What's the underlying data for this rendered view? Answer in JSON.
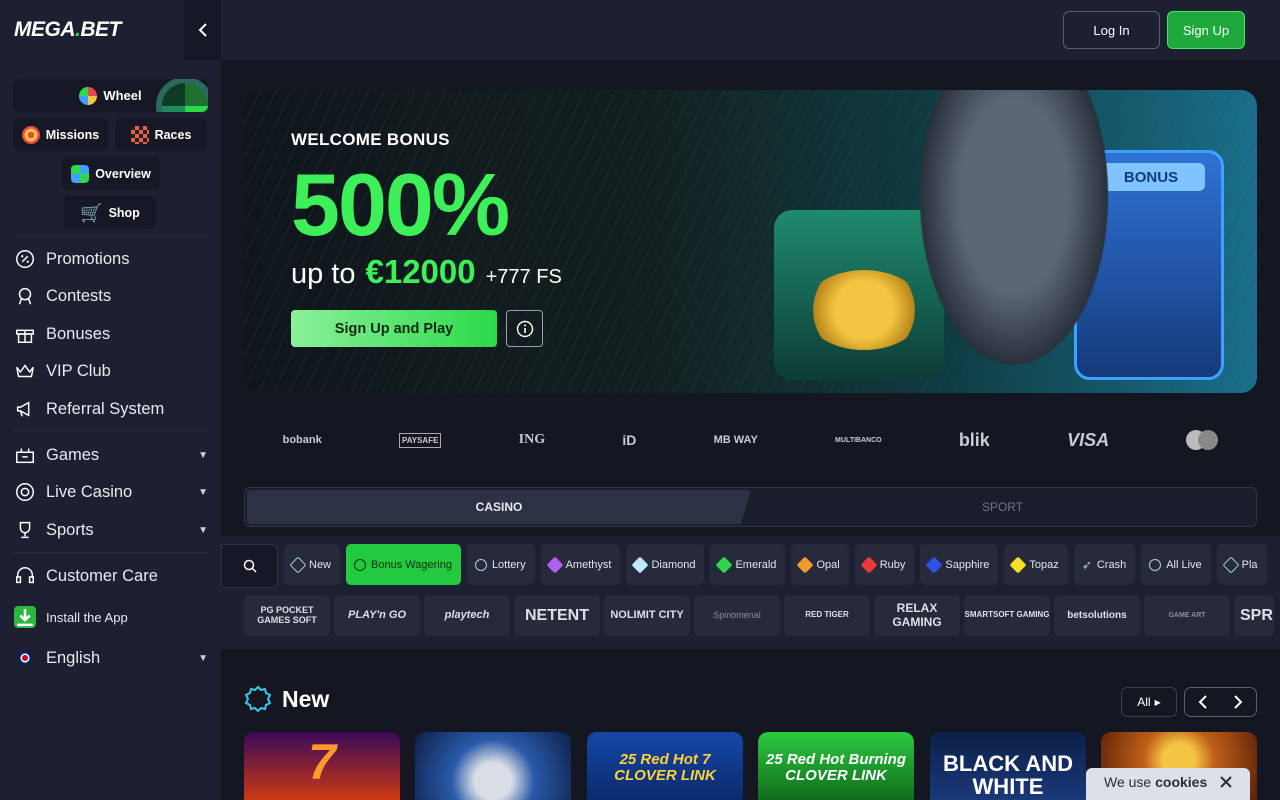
{
  "brand": {
    "logo_left": "MEGA",
    "logo_dot": ".",
    "logo_right": "BET"
  },
  "sidebar": {
    "wheel": "Wheel",
    "missions": "Missions",
    "races": "Races",
    "overview": "Overview",
    "shop": "Shop",
    "nav": [
      {
        "label": "Promotions",
        "icon": "promotion-badge-icon"
      },
      {
        "label": "Contests",
        "icon": "contest-icon"
      },
      {
        "label": "Bonuses",
        "icon": "gift-icon"
      },
      {
        "label": "VIP Club",
        "icon": "crown-icon"
      },
      {
        "label": "Referral System",
        "icon": "megaphone-icon"
      }
    ],
    "nav2": [
      {
        "label": "Games",
        "icon": "games-icon"
      },
      {
        "label": "Live Casino",
        "icon": "live-casino-icon"
      },
      {
        "label": "Sports",
        "icon": "trophy-icon"
      }
    ],
    "customer_care": "Customer Care",
    "install_app": "Install the App",
    "language": "English"
  },
  "header": {
    "login": "Log In",
    "signup": "Sign Up"
  },
  "hero": {
    "title": "WELCOME BONUS",
    "percent": "500%",
    "up_to": "up to",
    "amount": "€12000",
    "free_spins": "+777 FS",
    "cta": "Sign Up and Play",
    "slot_label": "BONUS"
  },
  "payments": [
    "bobank",
    "PAYSAFE",
    "ING",
    "iD",
    "MB WAY",
    "MULTIBANCO",
    "blik",
    "VISA",
    "mastercard"
  ],
  "tabs": {
    "casino": "CASINO",
    "sport": "SPORT"
  },
  "categories": [
    "New",
    "Bonus Wagering",
    "Lottery",
    "Amethyst",
    "Diamond",
    "Emerald",
    "Opal",
    "Ruby",
    "Sapphire",
    "Topaz",
    "Crash",
    "All Live",
    "Pla"
  ],
  "providers": [
    "PG POCKET GAMES SOFT",
    "PLAY'n GO",
    "playtech",
    "NETENT",
    "NOLIMIT CITY",
    "Spinomenal",
    "RED TIGER",
    "RELAX GAMING",
    "SMARTSOFT GAMING",
    "betsolutions",
    "GAME ART",
    "SPR"
  ],
  "new_section": {
    "title": "New",
    "all": "All"
  },
  "games": [
    {
      "text": "7",
      "bg": "#2a0b3f"
    },
    {
      "text": "",
      "bg": "#1d3f7a"
    },
    {
      "text": "25 Red Hot 7 CLOVER LINK",
      "bg": "#0f3a8a"
    },
    {
      "text": "25 Red Hot Burning CLOVER LINK",
      "bg": "#1c8a2c"
    },
    {
      "text": "BLACK AND WHITE",
      "bg": "#0f2a5a"
    },
    {
      "text": "",
      "bg": "#b0500f"
    }
  ],
  "cookie": {
    "prefix": "We use",
    "word": "cookies"
  },
  "colors": {
    "accent": "#2bd94a",
    "sidebar": "#1d2030",
    "page": "#141621"
  }
}
